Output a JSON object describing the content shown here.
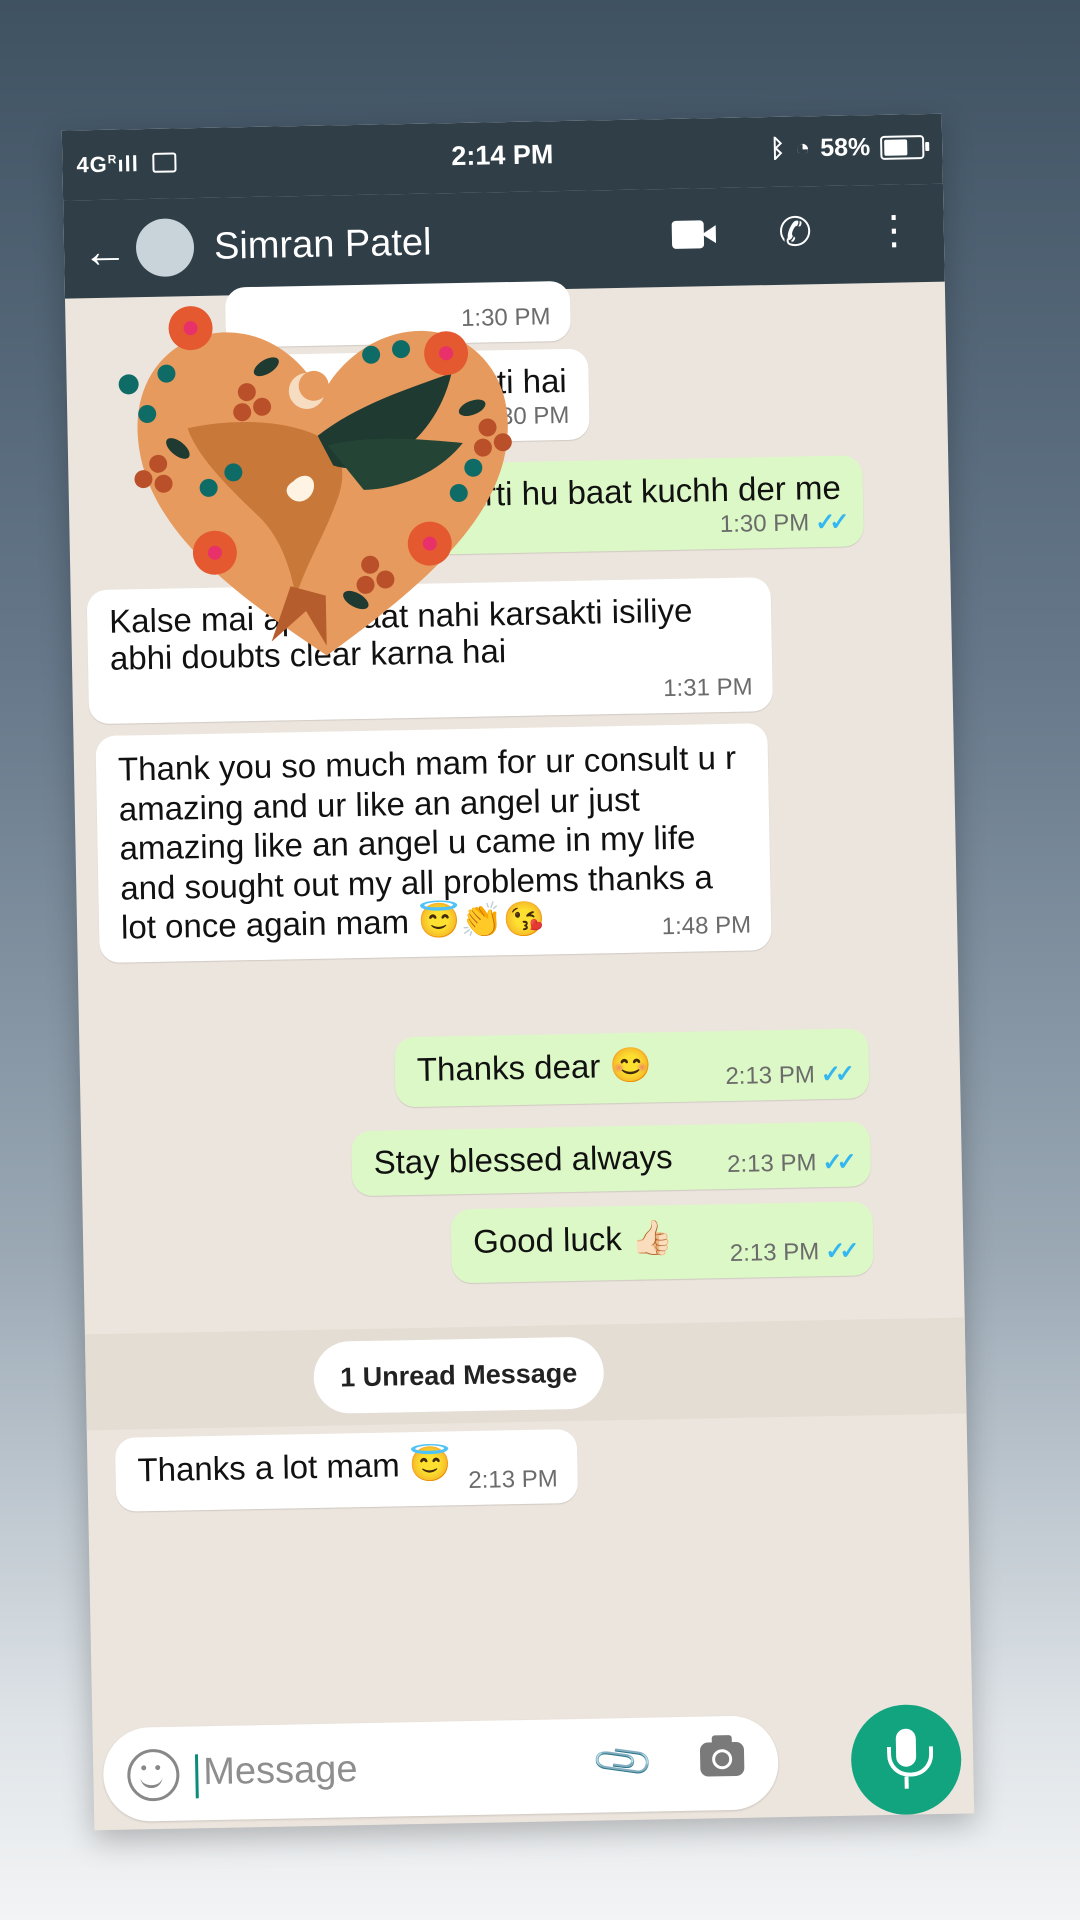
{
  "status_bar": {
    "network": "4G",
    "roaming": "R",
    "time": "2:14 PM",
    "battery_percent": "58%",
    "battery_level": 0.58
  },
  "app_bar": {
    "contact_name": "Simran Patel",
    "icons": [
      "back-arrow-icon",
      "video-call-icon",
      "phone-call-icon",
      "more-options-icon"
    ]
  },
  "messages": [
    {
      "direction": "in",
      "text": "",
      "time": "1:30 PM"
    },
    {
      "direction": "in",
      "text": "sakti hai",
      "time": "1:30 PM"
    },
    {
      "direction": "out",
      "text": "e Karti hu baat kuchh der me",
      "time": "1:30 PM",
      "read": true
    },
    {
      "direction": "in",
      "text": "Kalse mai apse baat nahi karsakti isiliye abhi doubts clear karna hai",
      "time": "1:31 PM"
    },
    {
      "direction": "in",
      "text": "Thank you so much mam for ur consult u r amazing and ur like an angel ur just amazing like an angel u came in my life and sought out my all problems thanks a lot once again mam",
      "emojis": "😇👏😘",
      "time": "1:48 PM"
    },
    {
      "direction": "out",
      "text": "Thanks dear",
      "emojis": "😊",
      "time": "2:13 PM",
      "read": true
    },
    {
      "direction": "out",
      "text": "Stay blessed always",
      "time": "2:13 PM",
      "read": true
    },
    {
      "direction": "out",
      "text": "Good luck",
      "emojis": "👍🏻",
      "time": "2:13 PM",
      "read": true
    },
    {
      "direction": "in",
      "text": "Thanks a lot mam",
      "emojis": "😇",
      "time": "2:13 PM"
    }
  ],
  "unread_banner": "1 Unread Message",
  "input": {
    "placeholder": "Message",
    "icons": [
      "emoji-icon",
      "attach-icon",
      "camera-icon",
      "mic-icon"
    ]
  },
  "colors": {
    "header": "#2f3e47",
    "chat_background": "#ece5dd",
    "outgoing_bubble": "#dcf8c6",
    "incoming_bubble": "#ffffff",
    "read_tick": "#34b7f1",
    "mic_button": "#12a37f"
  },
  "sticker": {
    "description_icon": "hummingbird-heart-sticker"
  }
}
